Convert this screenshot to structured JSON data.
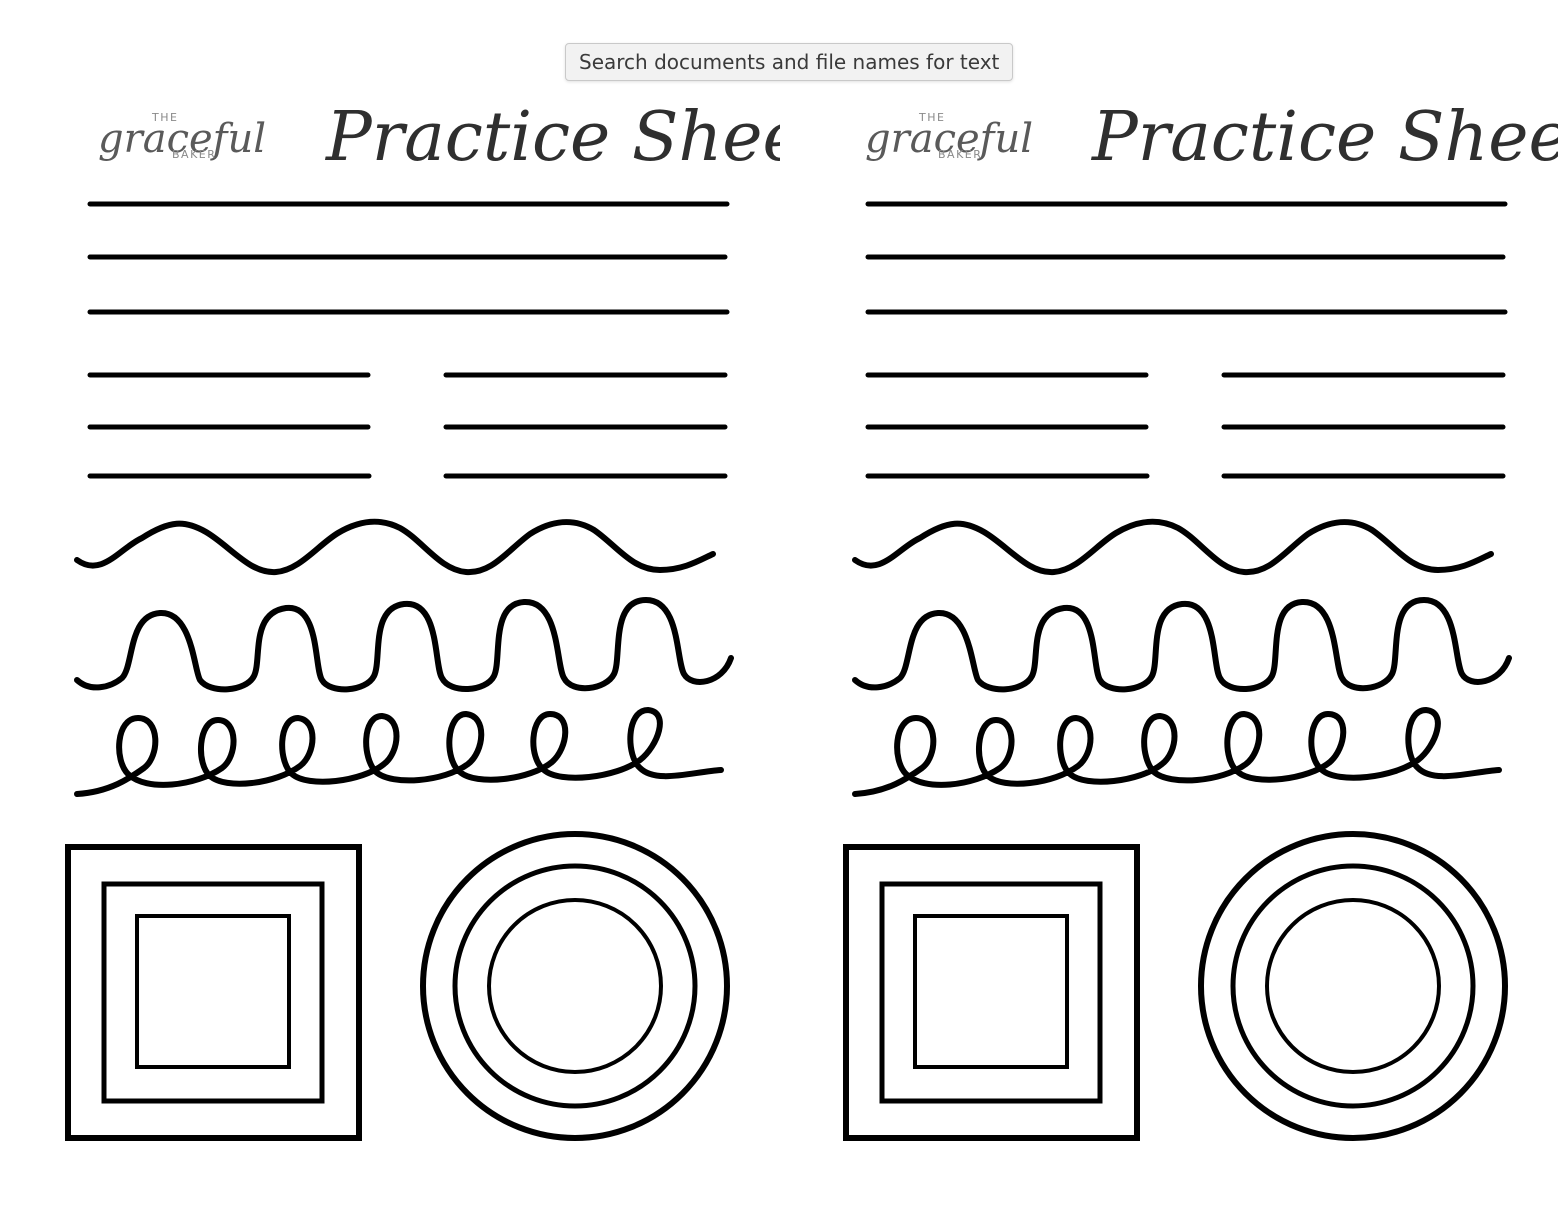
{
  "tooltip": {
    "text": "Search documents and file names for text"
  },
  "sheets": [
    {
      "logo": {
        "the": "THE",
        "script": "graceful",
        "baker": "BAKER"
      },
      "title": "Practice Sheet"
    },
    {
      "logo": {
        "the": "THE",
        "script": "graceful",
        "baker": "BAKER"
      },
      "title": "Practice Sheet"
    }
  ],
  "colors": {
    "ink": "#000000",
    "title": "#2f2f2f",
    "logo_gray": "#8a8a8a",
    "tooltip_bg": "#f2f2f2"
  }
}
